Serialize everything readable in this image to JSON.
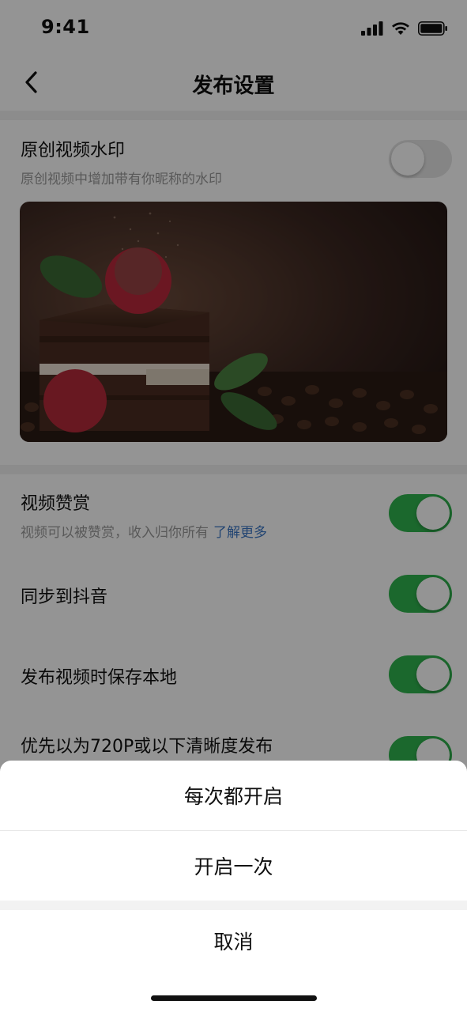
{
  "status_bar": {
    "time": "9:41",
    "icons": [
      "signal-icon",
      "wifi-icon",
      "battery-icon"
    ]
  },
  "nav": {
    "title": "发布设置",
    "back_icon": "chevron-left-icon"
  },
  "watermark": {
    "title": "原创视频水印",
    "subtitle": "原创视频中增加带有你昵称的水印",
    "enabled": false
  },
  "settings": [
    {
      "title": "视频赞赏",
      "subtitle": "视频可以被赞赏，收入归你所有",
      "link": "了解更多",
      "enabled": true
    },
    {
      "title": "同步到抖音",
      "enabled": true
    },
    {
      "title": "发布视频时保存本地",
      "enabled": true
    },
    {
      "title": "优先以为720P或以下清晰度发布",
      "enabled": true
    }
  ],
  "action_sheet": {
    "options": [
      "每次都开启",
      "开启一次"
    ],
    "cancel": "取消"
  },
  "colors": {
    "toggle_on": "#2fb34e",
    "link": "#3a76c4",
    "overlay": "rgba(0,0,0,0.42)"
  }
}
